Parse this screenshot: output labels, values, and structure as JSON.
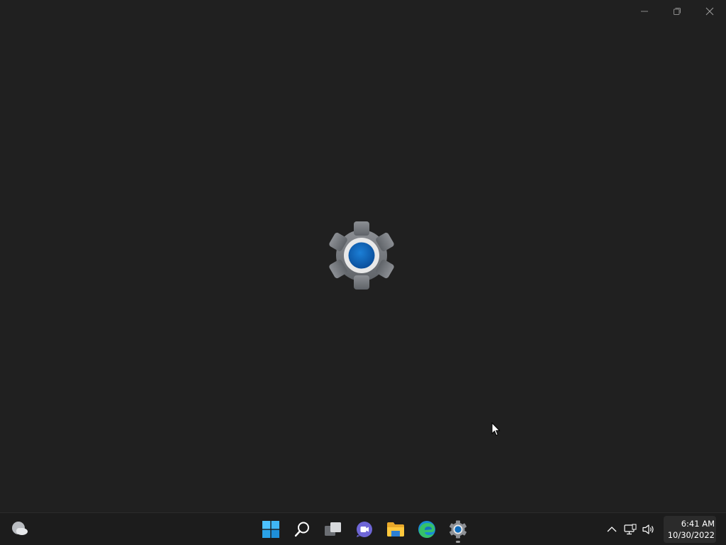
{
  "window": {
    "caption_buttons": [
      {
        "name": "minimize-button",
        "icon": "minimize-icon"
      },
      {
        "name": "restore-button",
        "icon": "restore-icon"
      },
      {
        "name": "close-button",
        "icon": "close-icon"
      }
    ],
    "splash_icon": "settings-gear-icon",
    "background": "#202020"
  },
  "taskbar": {
    "widgets_icon": "weather-cloudy-icon",
    "apps": [
      {
        "name": "start",
        "icon": "windows-start-icon",
        "running": false
      },
      {
        "name": "search",
        "icon": "search-icon",
        "running": false
      },
      {
        "name": "task-view",
        "icon": "task-view-icon",
        "running": false
      },
      {
        "name": "chat",
        "icon": "teams-chat-icon",
        "running": false
      },
      {
        "name": "file-explorer",
        "icon": "folder-icon",
        "running": false
      },
      {
        "name": "edge",
        "icon": "edge-browser-icon",
        "running": false
      },
      {
        "name": "settings",
        "icon": "settings-gear-icon",
        "running": true
      }
    ],
    "tray": {
      "icons": [
        "chevron-up-icon",
        "network-icon",
        "volume-icon"
      ],
      "time": "6:41 AM",
      "date": "10/30/2022"
    }
  },
  "colors": {
    "accent_blue": "#0f6cbd",
    "windows_blue": "#4cc2ff",
    "folder_yellow": "#ffc83d"
  }
}
